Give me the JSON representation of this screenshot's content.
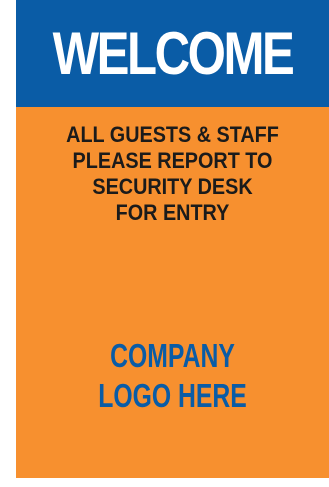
{
  "header": {
    "title": "WELCOME"
  },
  "message": {
    "lines": [
      "ALL GUESTS & STAFF",
      "PLEASE REPORT TO",
      "SECURITY DESK",
      "FOR ENTRY"
    ]
  },
  "logo": {
    "lines": [
      "COMPANY",
      "LOGO HERE"
    ]
  },
  "colors": {
    "background": "#f7902f",
    "header": "#0a5ca6",
    "header_text": "#ffffff",
    "message_text": "#1b1b1b",
    "logo_text": "#0a5ca6"
  }
}
